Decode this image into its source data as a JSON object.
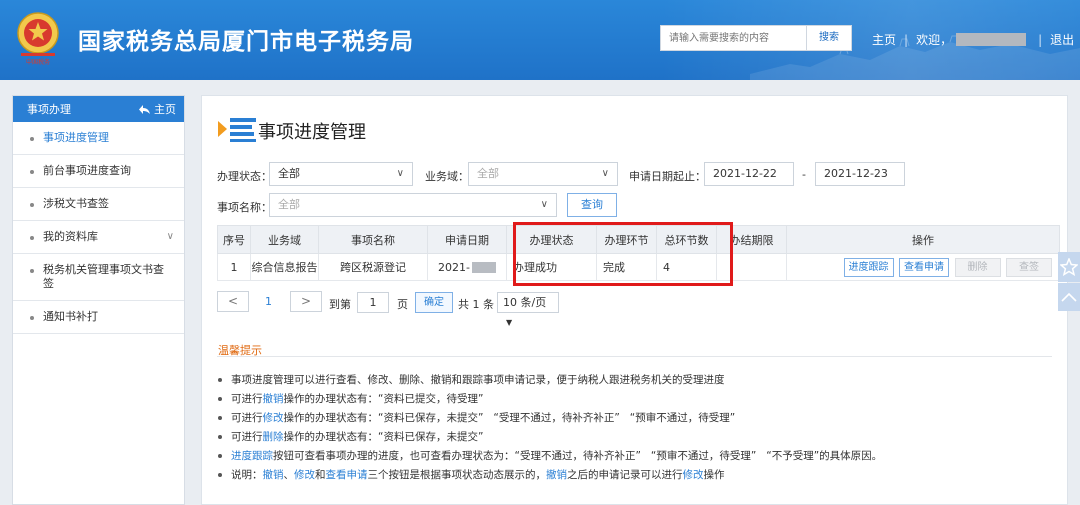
{
  "header": {
    "title": "国家税务总局厦门市电子税务局",
    "search_placeholder": "请输入需要搜索的内容",
    "search_button": "搜索",
    "home_link": "主页",
    "welcome": "欢迎，",
    "logout": "退出",
    "separator": "|"
  },
  "sidebar": {
    "header": "事项办理",
    "home": "主页",
    "items": [
      {
        "label": "事项进度管理"
      },
      {
        "label": "前台事项进度查询"
      },
      {
        "label": "涉税文书查签"
      },
      {
        "label": "我的资料库"
      },
      {
        "label": "税务机关管理事项文书查签"
      },
      {
        "label": "通知书补打"
      }
    ]
  },
  "main": {
    "title": "事项进度管理",
    "filters": {
      "status_label": "办理状态：",
      "status_value": "全部",
      "domain_label": "业务域：",
      "domain_value": "全部",
      "date_label": "申请日期起止：",
      "date_start": "2021-12-22",
      "date_sep": "-",
      "date_end": "2021-12-23",
      "item_label": "事项名称：",
      "item_value": "全部",
      "query_button": "查询"
    },
    "table": {
      "headers": [
        "序号",
        "业务域",
        "事项名称",
        "申请日期",
        "办理状态",
        "办理环节",
        "总环节数",
        "办结期限",
        "操作"
      ],
      "row": {
        "seq": "1",
        "domain": "综合信息报告",
        "item": "跨区税源登记",
        "date": "2021-",
        "status": "办理成功",
        "stage": "完成",
        "total_stages": "4",
        "deadline": "",
        "ops": [
          "进度跟踪",
          "查看申请",
          "删除",
          "查签"
        ]
      }
    },
    "pagination": {
      "prev": "<",
      "page": "1",
      "next": ">",
      "goto": "到第",
      "goto_value": "1",
      "page_unit": "页",
      "confirm": "确定",
      "total": "共 1 条",
      "page_size": "10 条/页"
    },
    "tips": {
      "title": "温馨提示",
      "lines": {
        "l1": "事项进度管理可以进行查看、修改、删除、撤销和跟踪事项申请记录，便于纳税人跟进税务机关的受理进度",
        "l2_a": "可进行",
        "l2_link": "撤销",
        "l2_b": "操作的办理状态有：“资料已提交，待受理”",
        "l3_a": "可进行",
        "l3_link": "修改",
        "l3_b": "操作的办理状态有：“资料已保存，未提交”   “受理不通过，待补齐补正”   “预审不通过，待受理”",
        "l4_a": "可进行",
        "l4_link": "删除",
        "l4_b": "操作的办理状态有：“资料已保存，未提交”",
        "l5_link": "进度跟踪",
        "l5_b": "按钮可查看事项办理的进度，也可查看办理状态为：“受理不通过，待补齐补正”   “预审不通过，待受理”   “不予受理”的具体原因。",
        "l6_a": "说明：",
        "l6_link1": "撤销",
        "l6_sep": "、",
        "l6_link2": "修改",
        "l6_and": "和",
        "l6_link3": "查看申请",
        "l6_mid": "三个按钮是根据事项状态动态展示的，",
        "l6_link4": "撤销",
        "l6_mid2": "之后的申请记录可以进行",
        "l6_link5": "修改",
        "l6_end": "操作"
      }
    }
  },
  "colors": {
    "header_blue": "#1f72c8",
    "accent": "#2a7fd4",
    "highlight_red": "#e01a1a",
    "tips_orange": "#e06a12"
  },
  "icons": {
    "emblem": "national-tax-emblem",
    "home": "back-arrow-icon",
    "page": "list-icon",
    "star": "star-icon",
    "up": "chevron-up-icon"
  }
}
